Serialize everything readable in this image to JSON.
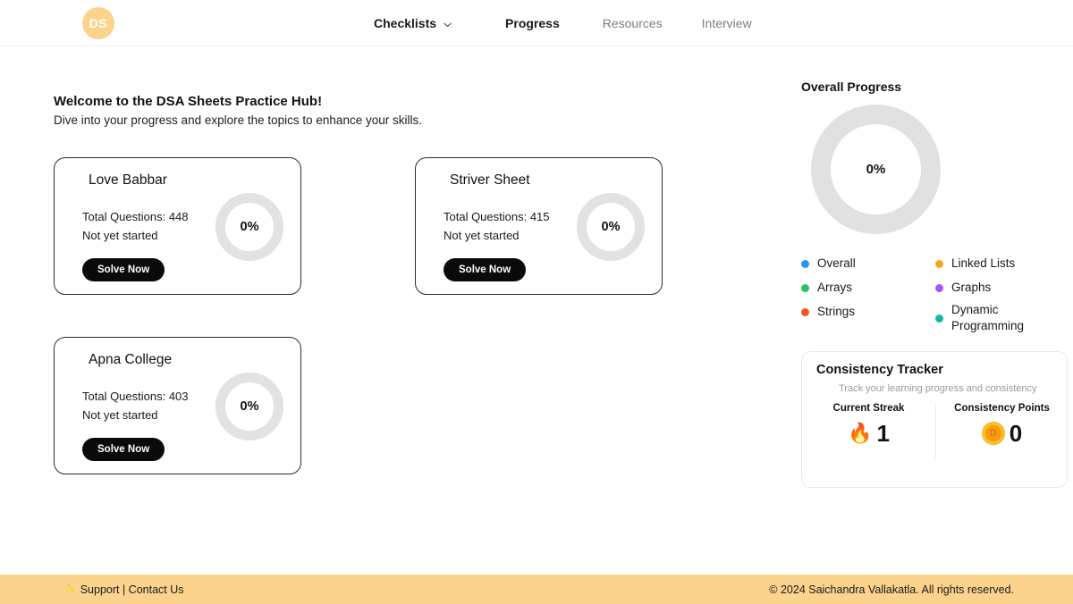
{
  "header": {
    "logo_text": "DS",
    "nav": [
      {
        "label": "Checklists",
        "active": true,
        "has_chevron": true
      },
      {
        "label": "Progress",
        "active": true,
        "has_chevron": false
      },
      {
        "label": "Resources",
        "active": false,
        "has_chevron": false
      },
      {
        "label": "Interview",
        "active": false,
        "has_chevron": false
      }
    ]
  },
  "main": {
    "welcome_title": "Welcome to the DSA Sheets Practice Hub!",
    "welcome_subtitle": "Dive into your progress and explore the topics to enhance your skills.",
    "cards": [
      {
        "title": "Love Babbar",
        "total": "Total Questions: 448",
        "status": "Not yet started",
        "button": "Solve Now",
        "percent": "0%"
      },
      {
        "title": "Striver Sheet",
        "total": "Total Questions: 415",
        "status": "Not yet started",
        "button": "Solve Now",
        "percent": "0%"
      },
      {
        "title": "Apna College",
        "total": "Total Questions: 403",
        "status": "Not yet started",
        "button": "Solve Now",
        "percent": "0%"
      }
    ]
  },
  "sidebar": {
    "overall_title": "Overall Progress",
    "overall_percent": "0%",
    "legend": [
      {
        "label": "Overall",
        "color": "#2196f3"
      },
      {
        "label": "Linked Lists",
        "color": "#f5a623"
      },
      {
        "label": "Arrays",
        "color": "#22c55e"
      },
      {
        "label": "Graphs",
        "color": "#a855f7"
      },
      {
        "label": "Strings",
        "color": "#f4541d"
      },
      {
        "label": "Dynamic Programming",
        "color": "#14b8a6"
      }
    ],
    "tracker": {
      "title": "Consistency Tracker",
      "subtitle": "Track your learning progress and consistency",
      "streak_label": "Current Streak",
      "streak_value": "1",
      "streak_icon": "fire-icon",
      "points_label": "Consistency Points",
      "points_value": "0",
      "points_icon": "coin-icon",
      "coin_letter": "D"
    }
  },
  "footer": {
    "sparkle": "✨",
    "left_text": "Support | Contact Us",
    "right_text": "© 2024 Saichandra Vallakatla. All rights reserved."
  },
  "chart_data": {
    "type": "pie",
    "title": "Overall Progress",
    "labels": [
      "Overall",
      "Arrays",
      "Strings",
      "Linked Lists",
      "Graphs",
      "Dynamic Programming"
    ],
    "values": [
      0,
      0,
      0,
      0,
      0,
      0
    ],
    "colors": [
      "#2196f3",
      "#22c55e",
      "#f4541d",
      "#f5a623",
      "#a855f7",
      "#14b8a6"
    ],
    "center_label": "0%",
    "legend_position": "bottom",
    "empty_track_color": "#e1e1e1"
  }
}
